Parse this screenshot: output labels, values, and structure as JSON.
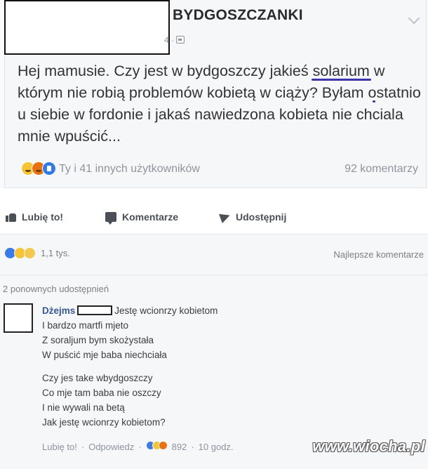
{
  "shared_post": {
    "group_name": "BYDGOSZCZANKI",
    "meta": "4 ·",
    "text_before": "Hej mamusie. Czy jest w bydgoszczy jakieś ",
    "text_highlight_1": "solarium",
    "text_line2_start": "",
    "text_highlight_2": "w którym nie robią problemów kobietą w ciąży",
    "text_after": "? Byłam ostatnio u siebie w fordonie i jakaś nawiedzona kobieta nie chciala mnie wpuścić...",
    "reactions_who": "Ty i 41 innych użytkowników",
    "comment_count": "92 komentarzy"
  },
  "actions": {
    "like_label": "Lubię to!",
    "comment_label": "Komentarze",
    "share_label": "Udostępnij"
  },
  "summary": {
    "reaction_count": "1,1 tys.",
    "best_comments": "Najlepsze komentarze"
  },
  "shares": {
    "text": "2 ponownych udostępnień"
  },
  "comment": {
    "author": "Dżejms",
    "lines_stanza1": [
      "Jestę wcionrzy kobietom",
      "I bardzo martfi mjeto",
      "Z soraljum bym skożystała",
      "W puścić mje baba niechciała"
    ],
    "lines_stanza2": [
      "Czy jes take wbydgoszczy",
      "Co mje tam baba nie oszczy",
      "I nie wywali na betą",
      "Jak jestę wcionrzy kobietom?"
    ],
    "like_label": "Lubię to!",
    "reply_label": "Odpowiedz",
    "separator": "·",
    "reaction_count": "892",
    "time": "10 godz."
  },
  "watermark": "www.wiocha.pl",
  "colors": {
    "link_blue": "#365899",
    "underline_purple": "#3a35a8",
    "muted_gray": "#90949c"
  }
}
